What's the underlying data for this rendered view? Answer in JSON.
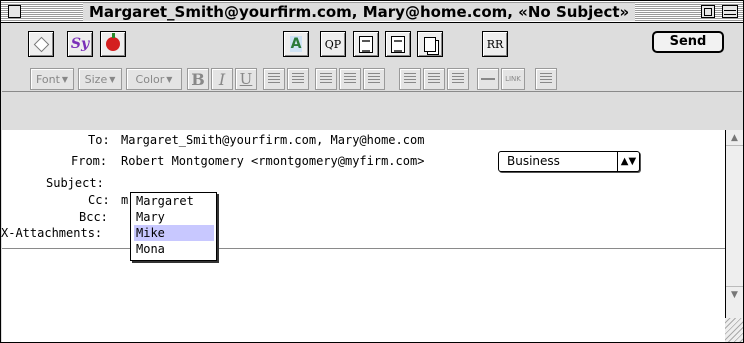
{
  "window": {
    "title": "Margaret_Smith@yourfirm.com, Mary@home.com, «No Subject»"
  },
  "toolbar": {
    "send_label": "Send",
    "qp_label": "QP",
    "rr_label": "RR"
  },
  "format_bar": {
    "font_label": "Font",
    "size_label": "Size",
    "color_label": "Color",
    "bold_label": "B",
    "italic_label": "I",
    "underline_label": "U",
    "link_label": "LINK"
  },
  "header": {
    "to_label": "To:",
    "to_value": "Margaret_Smith@yourfirm.com, Mary@home.com",
    "from_label": "From:",
    "from_value": "Robert Montgomery <rmontgomery@myfirm.com>",
    "personality_value": "Business",
    "subject_label": "Subject:",
    "subject_value": "",
    "cc_label": "Cc:",
    "cc_value": "m",
    "bcc_label": "Bcc:",
    "attachments_label": "X-Attachments:"
  },
  "autocomplete": {
    "items": [
      {
        "label": "Margaret"
      },
      {
        "label": "Mary"
      },
      {
        "label": "Mike"
      },
      {
        "label": "Mona"
      }
    ],
    "selected_index": 2
  },
  "icons": [
    "close-box-icon",
    "zoom-box-icon",
    "windowshade-icon",
    "priority-icon",
    "signature-icon",
    "apple-icon",
    "spell-check-icon",
    "document-icon",
    "attach-icon",
    "copy-icon",
    "scroll-up-icon",
    "scroll-down-icon",
    "grow-box-icon"
  ],
  "colors": {
    "selection": "#c8c8ff",
    "window_chrome": "#dddddd"
  }
}
